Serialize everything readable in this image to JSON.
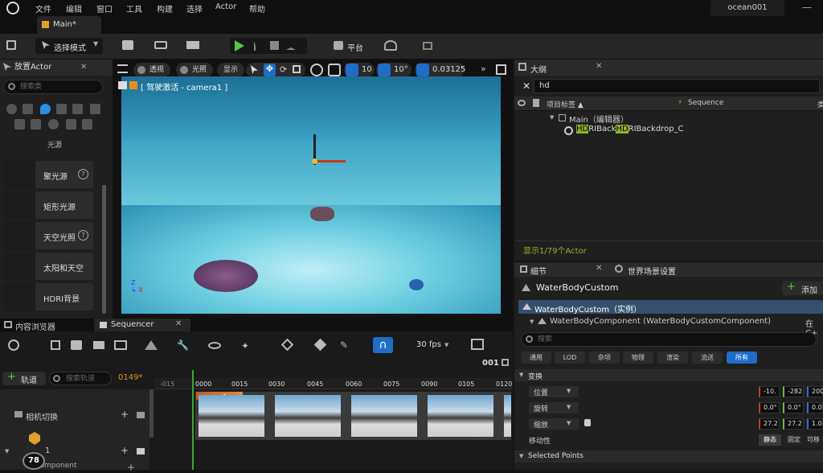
{
  "menu": {
    "items": [
      "文件",
      "编辑",
      "窗口",
      "工具",
      "构建",
      "选择",
      "Actor",
      "帮助"
    ],
    "project": "ocean001"
  },
  "tabs": {
    "main": "Main*"
  },
  "toolbar": {
    "select_mode": "选择模式",
    "platform": "平台"
  },
  "place_actor": {
    "title": "放置Actor",
    "search_placeholder": "搜索类",
    "category": "光源",
    "items": [
      {
        "label": "聚光源",
        "help": "?"
      },
      {
        "label": "矩形光源",
        "help": ""
      },
      {
        "label": "天空光照",
        "help": "?"
      },
      {
        "label": "太阳和天空",
        "help": ""
      },
      {
        "label": "HDRI背景",
        "help": ""
      }
    ]
  },
  "viewport": {
    "perspective": "透视",
    "lit": "光照",
    "show": "显示",
    "grid": "10",
    "angle": "10°",
    "scale": "0.03125",
    "pilot_label": "[ 驾驶激活 - camera1 ]"
  },
  "outline": {
    "title": "大纲",
    "search": "hd",
    "col_label": "项目标签 ▲",
    "col_sequence": "Sequence",
    "col_type": "类",
    "tree_main": "Main（编辑器）",
    "tree_item_hl1": "HD",
    "tree_item_mid": "RIBack",
    "tree_item_hl2": "HD",
    "tree_item_rest": "RIBackdrop_C",
    "status": "显示1/79个Actor"
  },
  "details": {
    "tab_details": "细节",
    "tab_world": "世界场景设置",
    "actor_name": "WaterBodyCustom",
    "add_label": "添加",
    "instance": "WaterBodyCustom（实例）",
    "component": "WaterBodyComponent (WaterBodyCustomComponent)",
    "component_right": "在C+",
    "search_placeholder": "搜索",
    "filters": [
      "通用",
      "LOD",
      "杂项",
      "物理",
      "渲染",
      "流送",
      "所有"
    ],
    "section_transform": "变换",
    "rows": [
      {
        "label": "位置",
        "x": "-10.",
        "y": "-282",
        "z": "200"
      },
      {
        "label": "旋转",
        "x": "0.0°",
        "y": "0.0°",
        "z": "0.0°"
      },
      {
        "label": "缩放",
        "x": "27.2",
        "y": "27.2",
        "z": "1.0"
      }
    ],
    "mobility": "移动性",
    "mob_static": "静态",
    "mob_fixed": "固定",
    "mob_movable": "可移",
    "section_selected": "Selected Points"
  },
  "bottom": {
    "tab_content": "内容浏览器",
    "tab_sequencer": "Sequencer",
    "fps": "30 fps",
    "frame_total": "001",
    "add_track": "轨道",
    "search_track": "搜索轨道",
    "current_frame": "0149*",
    "track_camera_cut": "相机切换",
    "track_camera": "1",
    "track_component": "raComponent",
    "clip_label": "camera1",
    "badge": "78",
    "ticks": [
      "-015",
      "0000",
      "0015",
      "0030",
      "0045",
      "0060",
      "0075",
      "0090",
      "0105",
      "0120"
    ]
  }
}
